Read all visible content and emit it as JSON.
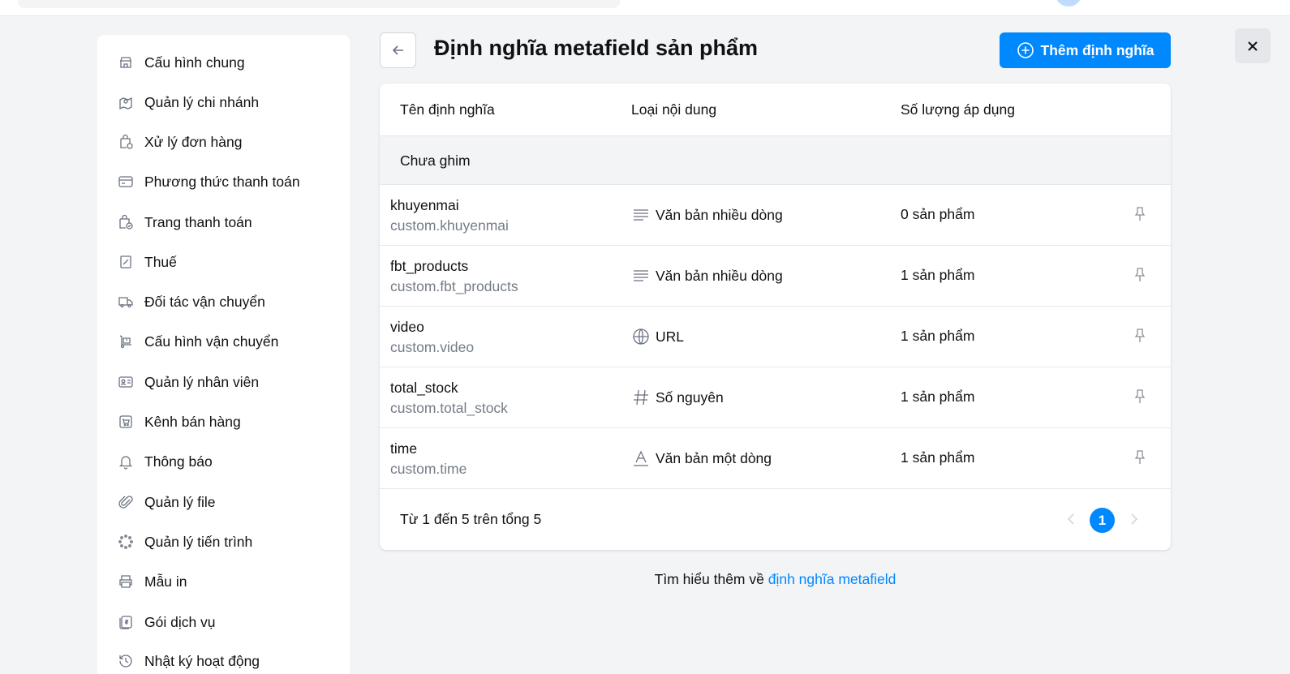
{
  "sidebar": {
    "items": [
      {
        "label": "Cấu hình chung",
        "icon": "store-icon"
      },
      {
        "label": "Quản lý chi nhánh",
        "icon": "location-icon"
      },
      {
        "label": "Xử lý đơn hàng",
        "icon": "order-bag-icon"
      },
      {
        "label": "Phương thức thanh toán",
        "icon": "credit-card-icon"
      },
      {
        "label": "Trang thanh toán",
        "icon": "checkout-bag-icon"
      },
      {
        "label": "Thuế",
        "icon": "tax-icon"
      },
      {
        "label": "Đối tác vận chuyển",
        "icon": "truck-icon"
      },
      {
        "label": "Cấu hình vận chuyển",
        "icon": "shipping-box-icon"
      },
      {
        "label": "Quản lý nhân viên",
        "icon": "id-card-icon"
      },
      {
        "label": "Kênh bán hàng",
        "icon": "cart-icon"
      },
      {
        "label": "Thông báo",
        "icon": "bell-icon"
      },
      {
        "label": "Quản lý file",
        "icon": "paperclip-icon"
      },
      {
        "label": "Quản lý tiến trình",
        "icon": "spinner-icon"
      },
      {
        "label": "Mẫu in",
        "icon": "printer-icon"
      },
      {
        "label": "Gói dịch vụ",
        "icon": "service-package-icon"
      },
      {
        "label": "Nhật ký hoạt động",
        "icon": "history-icon"
      }
    ]
  },
  "header": {
    "title": "Định nghĩa metafield sản phẩm",
    "add_button": "Thêm định nghĩa"
  },
  "table": {
    "columns": [
      "Tên định nghĩa",
      "Loại nội dung",
      "Số lượng áp dụng"
    ],
    "group_label": "Chưa ghim",
    "rows": [
      {
        "name": "khuyenmai",
        "key": "custom.khuyenmai",
        "type": "Văn bản nhiều dòng",
        "type_icon": "multiline-text-icon",
        "count": "0 sản phẩm"
      },
      {
        "name": "fbt_products",
        "key": "custom.fbt_products",
        "type": "Văn bản nhiều dòng",
        "type_icon": "multiline-text-icon",
        "count": "1 sản phẩm"
      },
      {
        "name": "video",
        "key": "custom.video",
        "type": "URL",
        "type_icon": "globe-icon",
        "count": "1 sản phẩm"
      },
      {
        "name": "total_stock",
        "key": "custom.total_stock",
        "type": "Số nguyên",
        "type_icon": "hash-icon",
        "count": "1 sản phẩm"
      },
      {
        "name": "time",
        "key": "custom.time",
        "type": "Văn bản một dòng",
        "type_icon": "single-line-text-icon",
        "count": "1 sản phẩm"
      }
    ],
    "pagination": {
      "range_text": "Từ 1 đến 5 trên tổng 5",
      "current_page": "1"
    }
  },
  "footer": {
    "learn_prefix": "Tìm hiểu thêm về ",
    "learn_link": "định nghĩa metafield"
  },
  "colors": {
    "accent": "#0088ff",
    "background": "#f3f4f6"
  }
}
